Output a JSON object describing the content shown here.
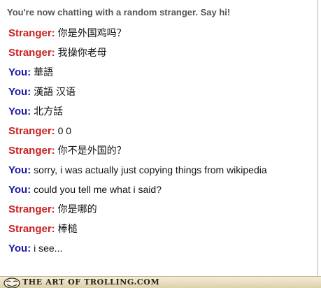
{
  "status": {
    "text": "You're now chatting with a random stranger. Say hi!"
  },
  "messages": [
    {
      "speaker": "Stranger:",
      "role": "stranger",
      "text": "你是外国鸡吗？"
    },
    {
      "speaker": "Stranger:",
      "role": "stranger",
      "text": "我操你老母"
    },
    {
      "speaker": "You:",
      "role": "you",
      "text": "華語"
    },
    {
      "speaker": "You:",
      "role": "you",
      "text": "漢語 汉语"
    },
    {
      "speaker": "You:",
      "role": "you",
      "text": "北方話"
    },
    {
      "speaker": "Stranger:",
      "role": "stranger",
      "text": "0 0"
    },
    {
      "speaker": "Stranger:",
      "role": "stranger",
      "text": "你不是外国的？"
    },
    {
      "speaker": "You:",
      "role": "you",
      "text": "sorry, i was actually just copying things from wikipedia"
    },
    {
      "speaker": "You:",
      "role": "you",
      "text": "could you tell me what i said?"
    },
    {
      "speaker": "Stranger:",
      "role": "stranger",
      "text": "你是哪的"
    },
    {
      "speaker": "Stranger:",
      "role": "stranger",
      "text": "棒槌"
    },
    {
      "speaker": "You:",
      "role": "you",
      "text": "i see..."
    }
  ],
  "colors": {
    "stranger": "#cc1f1f",
    "you": "#1a1aa6",
    "status": "#555555"
  },
  "watermark": {
    "text": "THE ART OF TROLLING.COM",
    "icon": "troll-face-icon"
  }
}
